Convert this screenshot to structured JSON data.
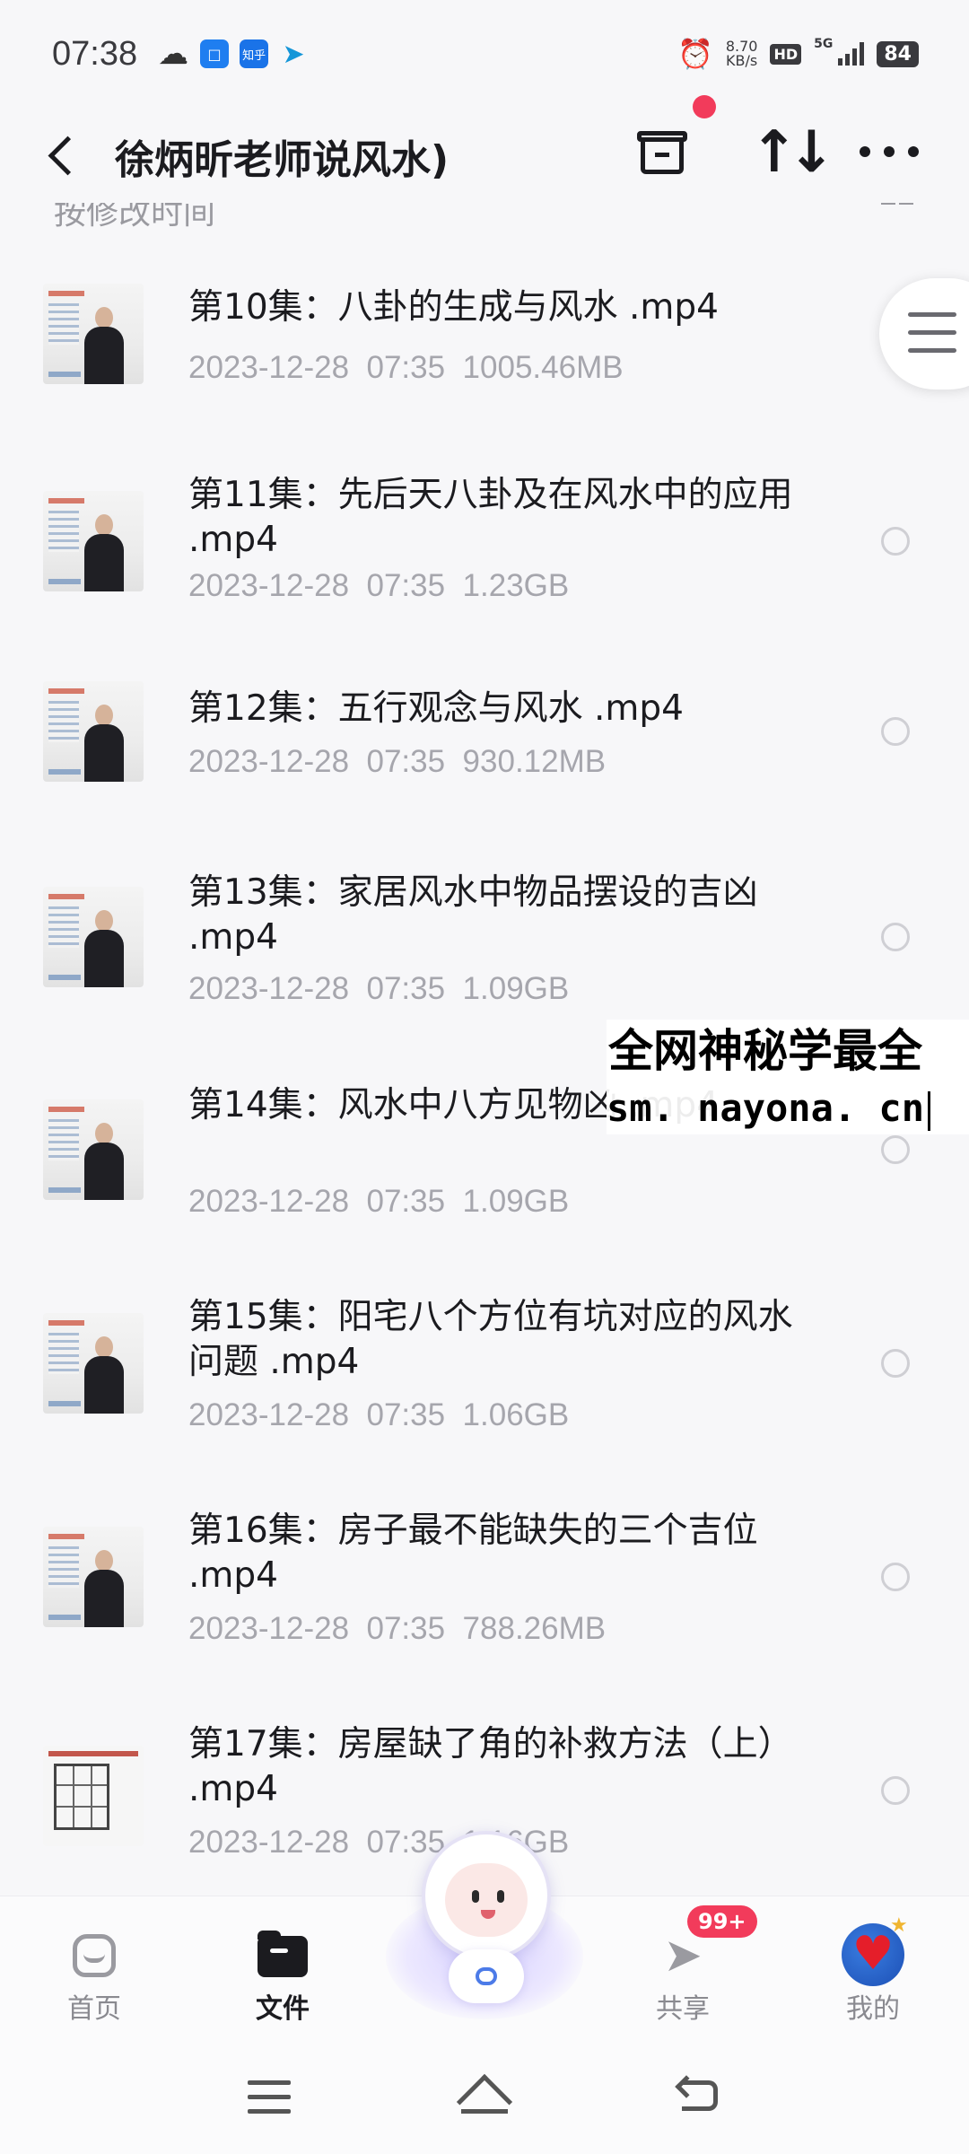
{
  "status_bar": {
    "time": "07:38",
    "zhihu_label": "知乎",
    "net_speed_value": "8.70",
    "net_speed_unit": "KB/s",
    "hd_label": "HD",
    "network_label": "5G",
    "battery": "84"
  },
  "header": {
    "title": "徐炳昕老师说风水)"
  },
  "sort_row": {
    "label": "按修改时间"
  },
  "files": [
    {
      "name": "第10集：八卦的生成与风水 .mp4",
      "date": "2023-12-28",
      "time": "07:35",
      "size": "1005.46MB"
    },
    {
      "name": "第11集：先后天八卦及在风水中的应用 .mp4",
      "date": "2023-12-28",
      "time": "07:35",
      "size": "1.23GB"
    },
    {
      "name": "第12集：五行观念与风水 .mp4",
      "date": "2023-12-28",
      "time": "07:35",
      "size": "930.12MB"
    },
    {
      "name": "第13集：家居风水中物品摆设的吉凶 .mp4",
      "date": "2023-12-28",
      "time": "07:35",
      "size": "1.09GB"
    },
    {
      "name": "第14集：风水中八方见物凶 .mp4",
      "date": "2023-12-28",
      "time": "07:35",
      "size": "1.09GB"
    },
    {
      "name": "第15集：阳宅八个方位有坑对应的风水问题 .mp4",
      "date": "2023-12-28",
      "time": "07:35",
      "size": "1.06GB"
    },
    {
      "name": "第16集：房子最不能缺失的三个吉位 .mp4",
      "date": "2023-12-28",
      "time": "07:35",
      "size": "788.26MB"
    },
    {
      "name": "第17集：房屋缺了角的补救方法（上） .mp4",
      "date": "2023-12-28",
      "time": "07:35",
      "size": "1.16GB"
    }
  ],
  "watermark": {
    "line1": "全网神秘学最全",
    "line2": "sm. nayona. cn"
  },
  "bottom_nav": {
    "home": "首页",
    "files": "文件",
    "share": "共享",
    "share_badge": "99+",
    "me": "我的"
  },
  "colors": {
    "accent_red": "#f23b5b",
    "text_primary": "#1b1b1f",
    "text_secondary": "#a6a6ad",
    "background": "#f7f7f9"
  }
}
